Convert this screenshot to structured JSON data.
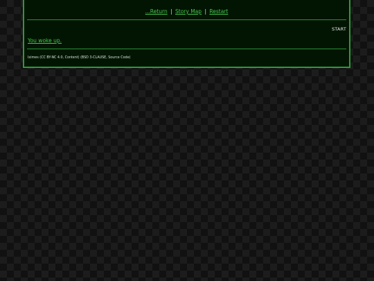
{
  "nav": {
    "return_label": "...Return",
    "separator": "|",
    "story_map_label": "Story Map",
    "restart_label": "Restart"
  },
  "passage": {
    "name": "START",
    "choice_label": "You woke up."
  },
  "footer": {
    "text": "Iximes (CC BY-NC 4.0, Content) (BSD 3-CLAUSE, Source Code)"
  },
  "colors": {
    "panel_background": "#021502",
    "border": "#2f9a3a",
    "link": "#48c64e",
    "text": "#d6e4d6"
  }
}
